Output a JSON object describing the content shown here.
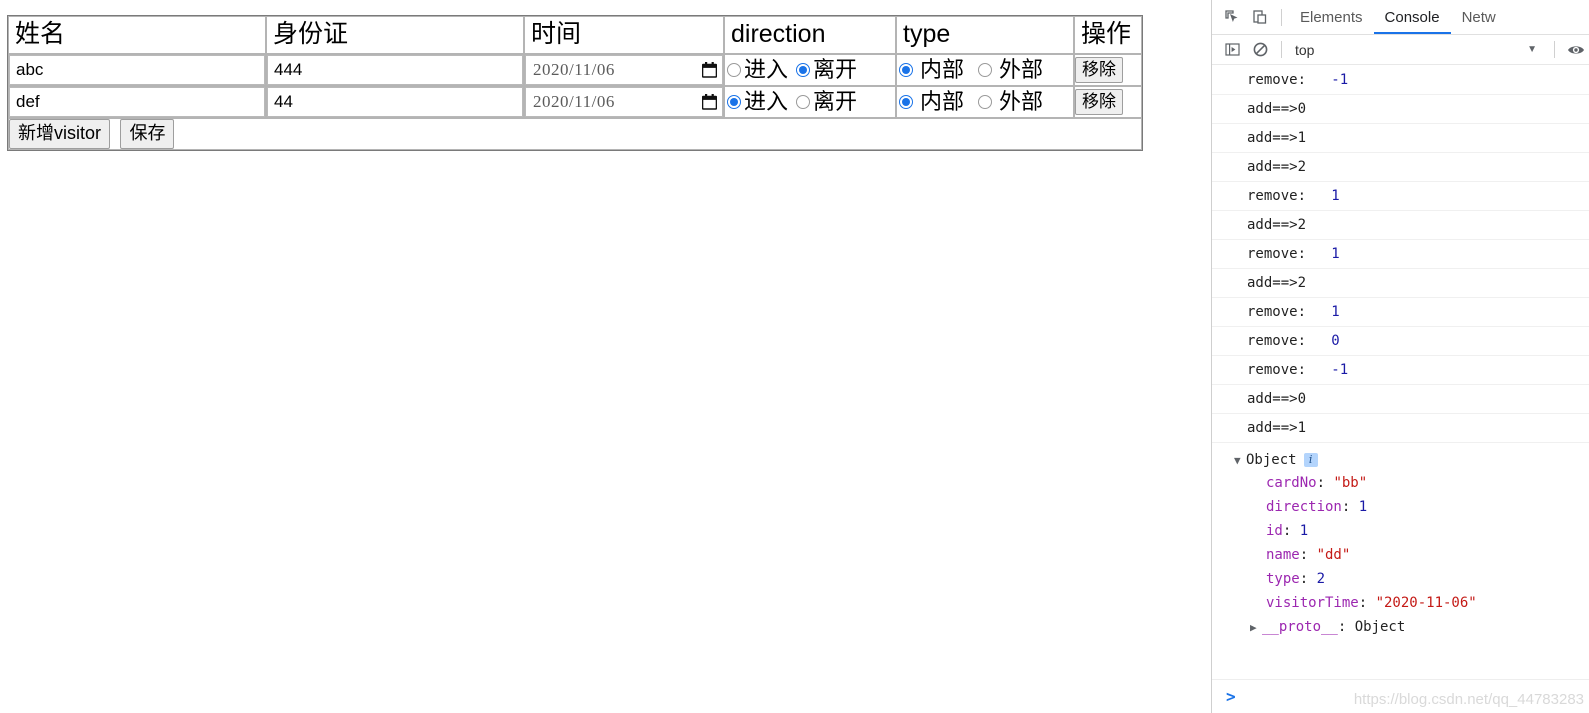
{
  "page": {
    "table": {
      "headers": [
        "姓名",
        "身份证",
        "时间",
        "direction",
        "type",
        "操作"
      ],
      "rows": [
        {
          "name": "abc",
          "card_no": "444",
          "time": "2020/11/06",
          "direction_options": [
            "进入",
            "离开"
          ],
          "direction_selected": 1,
          "type_options": [
            "内部",
            "外部"
          ],
          "type_selected": 0,
          "remove_label": "移除"
        },
        {
          "name": "def",
          "card_no": "44",
          "time": "2020/11/06",
          "direction_options": [
            "进入",
            "离开"
          ],
          "direction_selected": 0,
          "type_options": [
            "内部",
            "外部"
          ],
          "type_selected": 0,
          "remove_label": "移除"
        }
      ],
      "footer": {
        "add_label": "新增visitor",
        "save_label": "保存"
      }
    }
  },
  "devtools": {
    "toolbar": {
      "inspect_icon": "inspect-cursor-icon",
      "device_icon": "device-toolbar-icon",
      "tabs": [
        {
          "label": "Elements",
          "active": false
        },
        {
          "label": "Console",
          "active": true
        },
        {
          "label": "Netw",
          "active": false
        }
      ]
    },
    "toolbar2": {
      "sidebar_icon": "console-sidebar-icon",
      "clear_icon": "clear-console-icon",
      "context": "top",
      "caret": "▼",
      "eye_icon": "eye-icon"
    },
    "console": {
      "logs": [
        {
          "text": "remove:",
          "value": "-1"
        },
        {
          "text": "add==>0",
          "value": ""
        },
        {
          "text": "add==>1",
          "value": ""
        },
        {
          "text": "add==>2",
          "value": ""
        },
        {
          "text": "remove:",
          "value": "1"
        },
        {
          "text": "add==>2",
          "value": ""
        },
        {
          "text": "remove:",
          "value": "1"
        },
        {
          "text": "add==>2",
          "value": ""
        },
        {
          "text": "remove:",
          "value": "1"
        },
        {
          "text": "remove:",
          "value": "0"
        },
        {
          "text": "remove:",
          "value": "-1"
        },
        {
          "text": "add==>0",
          "value": ""
        },
        {
          "text": "add==>1",
          "value": ""
        }
      ],
      "object": {
        "triangle": "▼",
        "label": "Object",
        "info": "i",
        "properties": [
          {
            "key": "cardNo",
            "value": "\"bb\"",
            "kind": "str"
          },
          {
            "key": "direction",
            "value": "1",
            "kind": "num"
          },
          {
            "key": "id",
            "value": "1",
            "kind": "num"
          },
          {
            "key": "name",
            "value": "\"dd\"",
            "kind": "str"
          },
          {
            "key": "type",
            "value": "2",
            "kind": "num"
          },
          {
            "key": "visitorTime",
            "value": "\"2020-11-06\"",
            "kind": "str"
          }
        ],
        "proto": {
          "triangle": "▶",
          "key": "__proto__",
          "value": "Object"
        }
      },
      "prompt": ">",
      "watermark": "https://blog.csdn.net/qq_44783283"
    }
  }
}
